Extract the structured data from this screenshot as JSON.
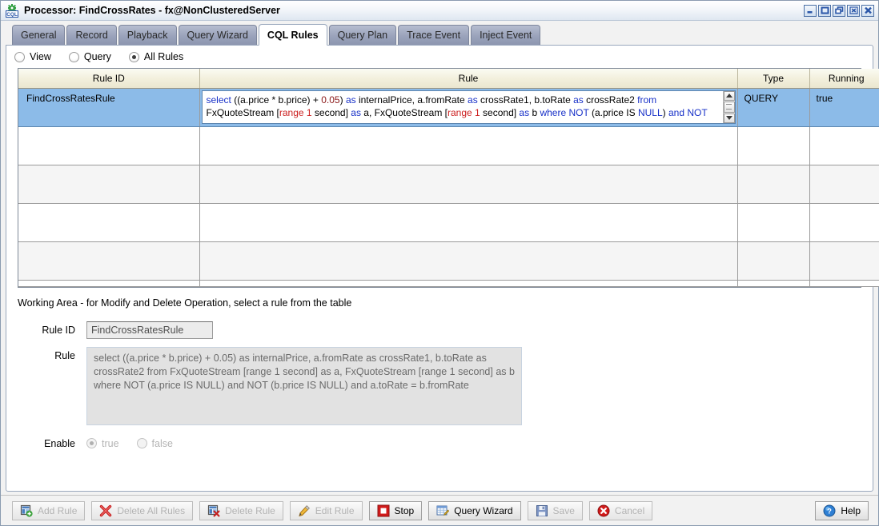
{
  "window": {
    "title": "Processor: FindCrossRates - fx@NonClusteredServer",
    "icon": "cql-app-icon",
    "controls": [
      {
        "name": "minimize-button",
        "icon": "minimize-icon"
      },
      {
        "name": "maximize-button",
        "icon": "maximize-icon"
      },
      {
        "name": "restore-button",
        "icon": "restore-icon"
      },
      {
        "name": "close-button",
        "icon": "close-icon"
      },
      {
        "name": "close-all-button",
        "icon": "close-all-icon"
      }
    ]
  },
  "tabs": [
    {
      "label": "General",
      "active": false
    },
    {
      "label": "Record",
      "active": false
    },
    {
      "label": "Playback",
      "active": false
    },
    {
      "label": "Query Wizard",
      "active": false
    },
    {
      "label": "CQL Rules",
      "active": true
    },
    {
      "label": "Query Plan",
      "active": false
    },
    {
      "label": "Trace Event",
      "active": false
    },
    {
      "label": "Inject Event",
      "active": false
    }
  ],
  "filter": {
    "options": [
      {
        "label": "View",
        "selected": false
      },
      {
        "label": "Query",
        "selected": false
      },
      {
        "label": "All Rules",
        "selected": true
      }
    ]
  },
  "table": {
    "columns": [
      "Rule ID",
      "Rule",
      "Type",
      "Running"
    ],
    "rows": [
      {
        "rule_id": "FindCrossRatesRule",
        "rule_line1": "select ((a.price * b.price) + 0.05) as internalPrice, a.fromRate as crossRate1, b.toRate as crossRate2 from",
        "rule_line2": "FxQuoteStream [range 1 second] as a, FxQuoteStream [range 1 second] as b where NOT (a.price IS NULL) and NOT",
        "type": "QUERY",
        "running": "true",
        "selected": true
      },
      {
        "rule_id": "",
        "rule_line1": "",
        "rule_line2": "",
        "type": "",
        "running": "",
        "selected": false
      },
      {
        "rule_id": "",
        "rule_line1": "",
        "rule_line2": "",
        "type": "",
        "running": "",
        "selected": false
      },
      {
        "rule_id": "",
        "rule_line1": "",
        "rule_line2": "",
        "type": "",
        "running": "",
        "selected": false
      },
      {
        "rule_id": "",
        "rule_line1": "",
        "rule_line2": "",
        "type": "",
        "running": "",
        "selected": false
      },
      {
        "rule_id": "",
        "rule_line1": "",
        "rule_line2": "",
        "type": "",
        "running": "",
        "selected": false
      }
    ]
  },
  "working_area": {
    "title": "Working Area - for Modify and Delete Operation, select a rule from the table",
    "rule_id_label": "Rule ID",
    "rule_id_value": "FindCrossRatesRule",
    "rule_label": "Rule",
    "rule_value": "select ((a.price * b.price) + 0.05) as internalPrice, a.fromRate as crossRate1, b.toRate as crossRate2 from FxQuoteStream [range 1 second] as a, FxQuoteStream [range 1 second] as b where NOT (a.price IS NULL) and NOT (b.price IS NULL) and a.toRate = b.fromRate",
    "enable_label": "Enable",
    "enable_options": [
      {
        "label": "true",
        "selected": true
      },
      {
        "label": "false",
        "selected": false
      }
    ]
  },
  "buttons": [
    {
      "label": "Add Rule",
      "icon": "add-rule-icon",
      "enabled": false
    },
    {
      "label": "Delete All Rules",
      "icon": "delete-all-icon",
      "enabled": false
    },
    {
      "label": "Delete Rule",
      "icon": "delete-rule-icon",
      "enabled": false
    },
    {
      "label": "Edit Rule",
      "icon": "edit-pencil-icon",
      "enabled": false
    },
    {
      "label": "Stop",
      "icon": "stop-icon",
      "enabled": true
    },
    {
      "label": "Query Wizard",
      "icon": "query-wizard-icon",
      "enabled": true
    },
    {
      "label": "Save",
      "icon": "save-icon",
      "enabled": false
    },
    {
      "label": "Cancel",
      "icon": "cancel-icon",
      "enabled": false
    }
  ],
  "help_button": {
    "label": "Help",
    "icon": "help-icon"
  },
  "colors": {
    "selection_blue": "#8cbbe8",
    "keyword_blue": "#1831c8",
    "number_red": "#8c1a1a",
    "range_red": "#cc2020",
    "tab_grey": "#9aa3bb",
    "header_cream": "#f3f0dd"
  }
}
